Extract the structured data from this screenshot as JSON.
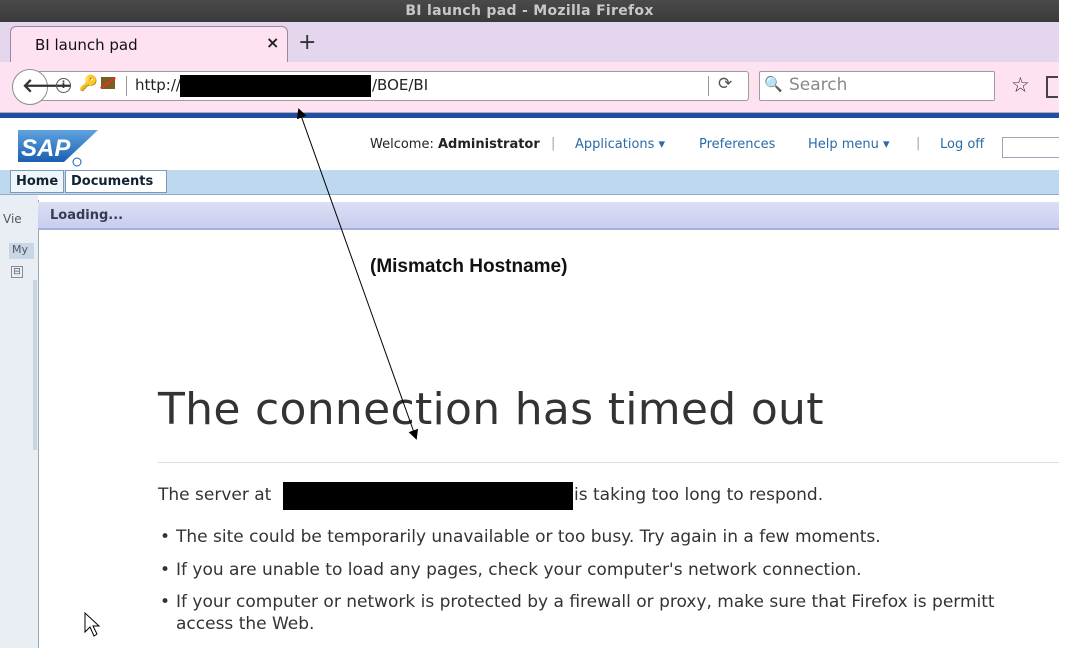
{
  "window": {
    "title": "BI launch pad - Mozilla Firefox"
  },
  "tab": {
    "title": "BI launch pad",
    "close": "×",
    "new_tab": "+"
  },
  "navbar": {
    "url_prefix": "http://",
    "url_path": "/BOE/BI",
    "search_placeholder": "Search",
    "back_icon": "arrow-left",
    "reload_icon": "reload"
  },
  "sap_header": {
    "logo_text": "SAP",
    "welcome_label": "Welcome:",
    "user": "Administrator",
    "menu": [
      {
        "label": "Applications ▾"
      },
      {
        "label": "Preferences"
      },
      {
        "label": "Help menu ▾"
      },
      {
        "label": "Log off"
      }
    ],
    "tabs": [
      {
        "label": "Home"
      },
      {
        "label": "Documents"
      }
    ]
  },
  "left_panel": {
    "view_label": "Vie",
    "my_label": "My",
    "tree_toggle": "⊟"
  },
  "loading_bar": {
    "text": "Loading..."
  },
  "annotation": {
    "text": "(Mismatch Hostname)"
  },
  "error": {
    "title": "The connection has timed out",
    "server_prefix": "The server at",
    "server_suffix": "is taking too long to respond.",
    "bullets": [
      "The site could be temporarily unavailable or too busy. Try again in a few moments.",
      "If you are unable to load any pages, check your computer's network connection.",
      "If your computer or network is protected by a firewall or proxy, make sure that Firefox is permitt",
      "access the Web."
    ]
  },
  "colors": {
    "tab_pink": "#ffe2f1",
    "sap_blue": "#1f4fa5",
    "link": "#2b6aa8"
  }
}
